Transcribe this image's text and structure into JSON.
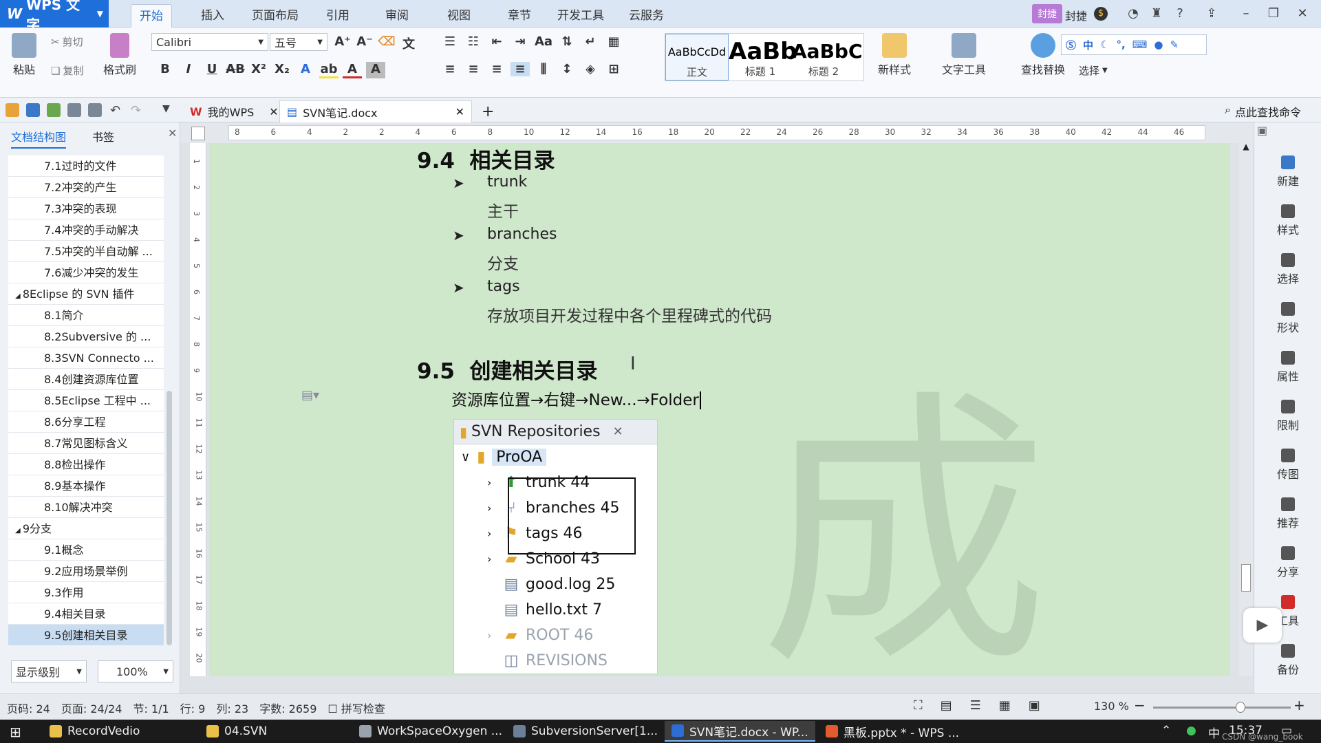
{
  "app": {
    "name": "WPS 文字"
  },
  "menu": {
    "tabs": [
      "开始",
      "插入",
      "页面布局",
      "引用",
      "审阅",
      "视图",
      "章节",
      "开发工具",
      "云服务"
    ],
    "active": "开始",
    "user": "封捷"
  },
  "ribbon": {
    "paste": "粘贴",
    "cut": "剪切",
    "copy": "复制",
    "format_painter": "格式刷",
    "font": "Calibri",
    "size": "五号",
    "styles": [
      {
        "sample": "AaBbCcDd",
        "label": "正文"
      },
      {
        "sample": "AaBb",
        "label": "标题 1"
      },
      {
        "sample": "AaBbC",
        "label": "标题 2"
      }
    ],
    "new_style": "新样式",
    "text_tools": "文字工具",
    "find_replace": "查找替换",
    "select": "选择",
    "ime": "中"
  },
  "tabs": {
    "home": "我的WPS",
    "doc": "SVN笔记.docx",
    "search": "点此查找命令"
  },
  "left_panel": {
    "tab_outline": "文档结构图",
    "tab_bookmark": "书签",
    "items": [
      {
        "label": "7.1过时的文件",
        "level": 2
      },
      {
        "label": "7.2冲突的产生",
        "level": 2
      },
      {
        "label": "7.3冲突的表现",
        "level": 2
      },
      {
        "label": "7.4冲突的手动解决",
        "level": 2
      },
      {
        "label": "7.5冲突的半自动解 ...",
        "level": 2
      },
      {
        "label": "7.6减少冲突的发生",
        "level": 2
      },
      {
        "label": "8Eclipse 的 SVN 插件",
        "level": 1
      },
      {
        "label": "8.1简介",
        "level": 2
      },
      {
        "label": "8.2Subversive 的 ...",
        "level": 2
      },
      {
        "label": "8.3SVN Connecto ...",
        "level": 2
      },
      {
        "label": "8.4创建资源库位置",
        "level": 2
      },
      {
        "label": "8.5Eclipse 工程中 ...",
        "level": 2
      },
      {
        "label": "8.6分享工程",
        "level": 2
      },
      {
        "label": "8.7常见图标含义",
        "level": 2
      },
      {
        "label": "8.8检出操作",
        "level": 2
      },
      {
        "label": "8.9基本操作",
        "level": 2
      },
      {
        "label": "8.10解决冲突",
        "level": 2
      },
      {
        "label": "9分支",
        "level": 1
      },
      {
        "label": "9.1概念",
        "level": 2
      },
      {
        "label": "9.2应用场景举例",
        "level": 2
      },
      {
        "label": "9.3作用",
        "level": 2
      },
      {
        "label": "9.4相关目录",
        "level": 2
      },
      {
        "label": "9.5创建相关目录",
        "level": 2
      }
    ],
    "selected": "9.5创建相关目录",
    "display_level": "显示级别",
    "zoom": "100%"
  },
  "ruler": {
    "h_labels": [
      "8",
      "6",
      "4",
      "2",
      "2",
      "4",
      "6",
      "8",
      "10",
      "12",
      "14",
      "16",
      "18",
      "20",
      "22",
      "24",
      "26",
      "28",
      "30",
      "32",
      "34",
      "36",
      "38",
      "40",
      "42",
      "44",
      "46"
    ],
    "v_labels": [
      "1",
      "2",
      "3",
      "4",
      "5",
      "6",
      "7",
      "8",
      "9",
      "10",
      "11",
      "12",
      "13",
      "14",
      "15",
      "16",
      "17",
      "18",
      "19",
      "20"
    ]
  },
  "doc": {
    "s94": {
      "num": "9.4",
      "title": "相关目录"
    },
    "bullets": [
      {
        "term": "trunk",
        "desc": "主干"
      },
      {
        "term": "branches",
        "desc": "分支"
      },
      {
        "term": "tags",
        "desc": "存放项目开发过程中各个里程碑式的代码"
      }
    ],
    "s95": {
      "num": "9.5",
      "title": "创建相关目录"
    },
    "path_text": "资源库位置→右键→New...→Folder"
  },
  "svn": {
    "title": "SVN Repositories",
    "root": "ProOA",
    "children": [
      {
        "label": "trunk 44",
        "icon": "trunk-icon",
        "expandable": true,
        "boxed": true
      },
      {
        "label": "branches 45",
        "icon": "branch-icon",
        "expandable": true,
        "boxed": true
      },
      {
        "label": "tags 46",
        "icon": "tag-icon",
        "expandable": true,
        "boxed": true
      },
      {
        "label": "School 43",
        "icon": "folder-icon",
        "expandable": true,
        "boxed": false
      },
      {
        "label": "good.log 25",
        "icon": "file-icon",
        "expandable": false,
        "boxed": false
      },
      {
        "label": "hello.txt 7",
        "icon": "file-icon",
        "expandable": false,
        "boxed": false
      },
      {
        "label": "ROOT 46",
        "icon": "folder-icon",
        "expandable": true,
        "boxed": false,
        "dim": true
      },
      {
        "label": "REVISIONS",
        "icon": "revisions-icon",
        "expandable": false,
        "boxed": false,
        "dim": true
      }
    ]
  },
  "right_bar": [
    "新建",
    "样式",
    "选择",
    "形状",
    "属性",
    "限制",
    "传图",
    "推荐",
    "分享",
    "工具",
    "备份"
  ],
  "status": {
    "page": "页码: 24",
    "pages": "页面: 24/24",
    "section": "节: 1/1",
    "row": "行: 9",
    "col": "列: 23",
    "words": "字数: 2659",
    "spell": "拼写检查",
    "zoom": "130 %"
  },
  "taskbar": {
    "items": [
      "RecordVedio",
      "04.SVN",
      "WorkSpaceOxygen ...",
      "SubversionServer[1...",
      "SVN笔记.docx - WP...",
      "黑板.pptx * - WPS ..."
    ],
    "active_index": 4,
    "ime": "中",
    "time": "15:37",
    "watermark": "CSDN @wang_book"
  },
  "colors": {
    "accent": "#1e6fd9",
    "page_bg": "#cfe7cb",
    "title_bar": "#dbe6f4"
  }
}
